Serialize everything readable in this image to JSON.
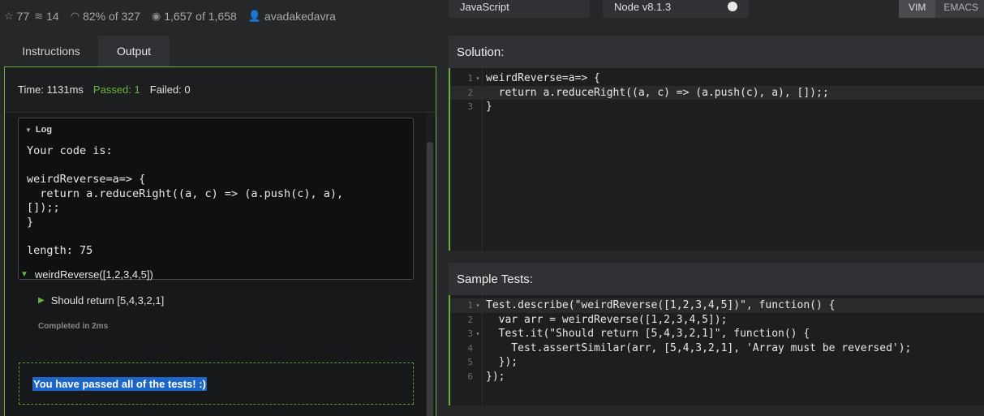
{
  "stats": {
    "stars": "77",
    "collections": "14",
    "satisfaction": "82% of 327",
    "completed": "1,657 of 1,658",
    "username": "avadakedavra"
  },
  "top": {
    "language": "JavaScript",
    "runtime": "Node v8.1.3",
    "mode_vim": "VIM",
    "mode_emacs": "EMACS"
  },
  "tabs": {
    "instructions": "Instructions",
    "output": "Output"
  },
  "summary": {
    "time": "Time: 1131ms",
    "passed": "Passed: 1",
    "failed": "Failed: 0"
  },
  "log": {
    "title": "Log",
    "content": "Your code is:\n\nweirdReverse=a=> {\n  return a.reduceRight((a, c) => (a.push(c), a),\n[]);;\n}\n\nlength: 75"
  },
  "results": {
    "describe": "weirdReverse([1,2,3,4,5])",
    "it": "Should return [5,4,3,2,1]",
    "completed": "Completed in 2ms",
    "passed_message": "You have passed all of the tests! :)"
  },
  "solution": {
    "title": "Solution:",
    "lines": [
      "weirdReverse=a=> {",
      "  return a.reduceRight((a, c) => (a.push(c), a), []);;",
      "}"
    ]
  },
  "sample_tests": {
    "title": "Sample Tests:",
    "lines": [
      "Test.describe(\"weirdReverse([1,2,3,4,5])\", function() {",
      "  var arr = weirdReverse([1,2,3,4,5]);",
      "  Test.it(\"Should return [5,4,3,2,1]\", function() {",
      "    Test.assertSimilar(arr, [5,4,3,2,1], 'Array must be reversed');",
      "  });",
      "});"
    ]
  },
  "colors": {
    "accent_green": "#6cae3a",
    "selection_blue": "#1c66c9",
    "background": "#262729"
  }
}
